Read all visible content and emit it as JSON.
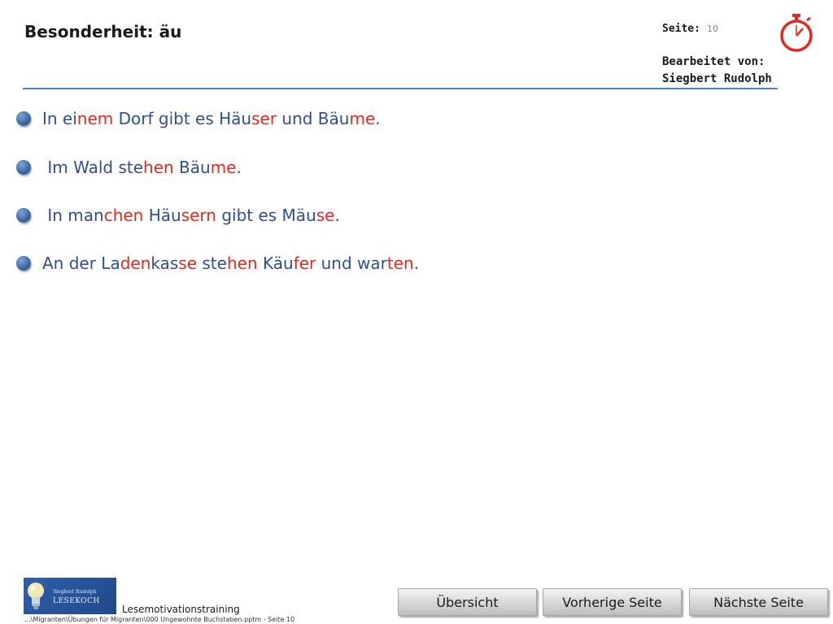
{
  "header": {
    "title": "Besonderheit: äu",
    "page_label": "Seite:",
    "page_number": "10",
    "edited_by_label": "Bearbeitet von:",
    "author": "Siegbert Rudolph",
    "timer_icon": "stopwatch-icon"
  },
  "colors": {
    "accent_blue": "#2e4f8f",
    "syllable_red": "#e3281e",
    "rule": "#4f81bd",
    "timer_red": "#e3281e"
  },
  "sentences": [
    {
      "segments": [
        {
          "text": "In ei",
          "color": "blue"
        },
        {
          "text": "nem",
          "color": "red"
        },
        {
          "text": " Dorf gibt es Häu",
          "color": "blue"
        },
        {
          "text": "ser",
          "color": "red"
        },
        {
          "text": " und Bäu",
          "color": "blue"
        },
        {
          "text": "me",
          "color": "red"
        },
        {
          "text": ".",
          "color": "blue"
        }
      ]
    },
    {
      "segments": [
        {
          "text": " Im Wald ste",
          "color": "blue"
        },
        {
          "text": "hen",
          "color": "red"
        },
        {
          "text": " Bäu",
          "color": "blue"
        },
        {
          "text": "me",
          "color": "red"
        },
        {
          "text": ".",
          "color": "blue"
        }
      ]
    },
    {
      "segments": [
        {
          "text": " In man",
          "color": "blue"
        },
        {
          "text": "chen",
          "color": "red"
        },
        {
          "text": " Häu",
          "color": "blue"
        },
        {
          "text": "sern",
          "color": "red"
        },
        {
          "text": " gibt es Mäu",
          "color": "blue"
        },
        {
          "text": "se",
          "color": "red"
        },
        {
          "text": ".",
          "color": "blue"
        }
      ]
    },
    {
      "segments": [
        {
          "text": "An der La",
          "color": "blue"
        },
        {
          "text": "den",
          "color": "red"
        },
        {
          "text": "kas",
          "color": "blue"
        },
        {
          "text": "se",
          "color": "red"
        },
        {
          "text": " ste",
          "color": "blue"
        },
        {
          "text": "hen",
          "color": "red"
        },
        {
          "text": " Käu",
          "color": "blue"
        },
        {
          "text": "fer",
          "color": "red"
        },
        {
          "text": " und war",
          "color": "blue"
        },
        {
          "text": "ten",
          "color": "red"
        },
        {
          "text": ".",
          "color": "blue"
        }
      ]
    }
  ],
  "footer": {
    "logo_small": "Siegbert Rudolph",
    "logo_big": "LESEKOCH",
    "title": "Lesemotivationstraining",
    "path": "...\\Migranten\\Übungen für Migranten\\000 Ungewohnte Buchstaben.pptm - Seite 10",
    "buttons": {
      "overview": "Übersicht",
      "previous": "Vorherige Seite",
      "next": "Nächste Seite"
    }
  }
}
